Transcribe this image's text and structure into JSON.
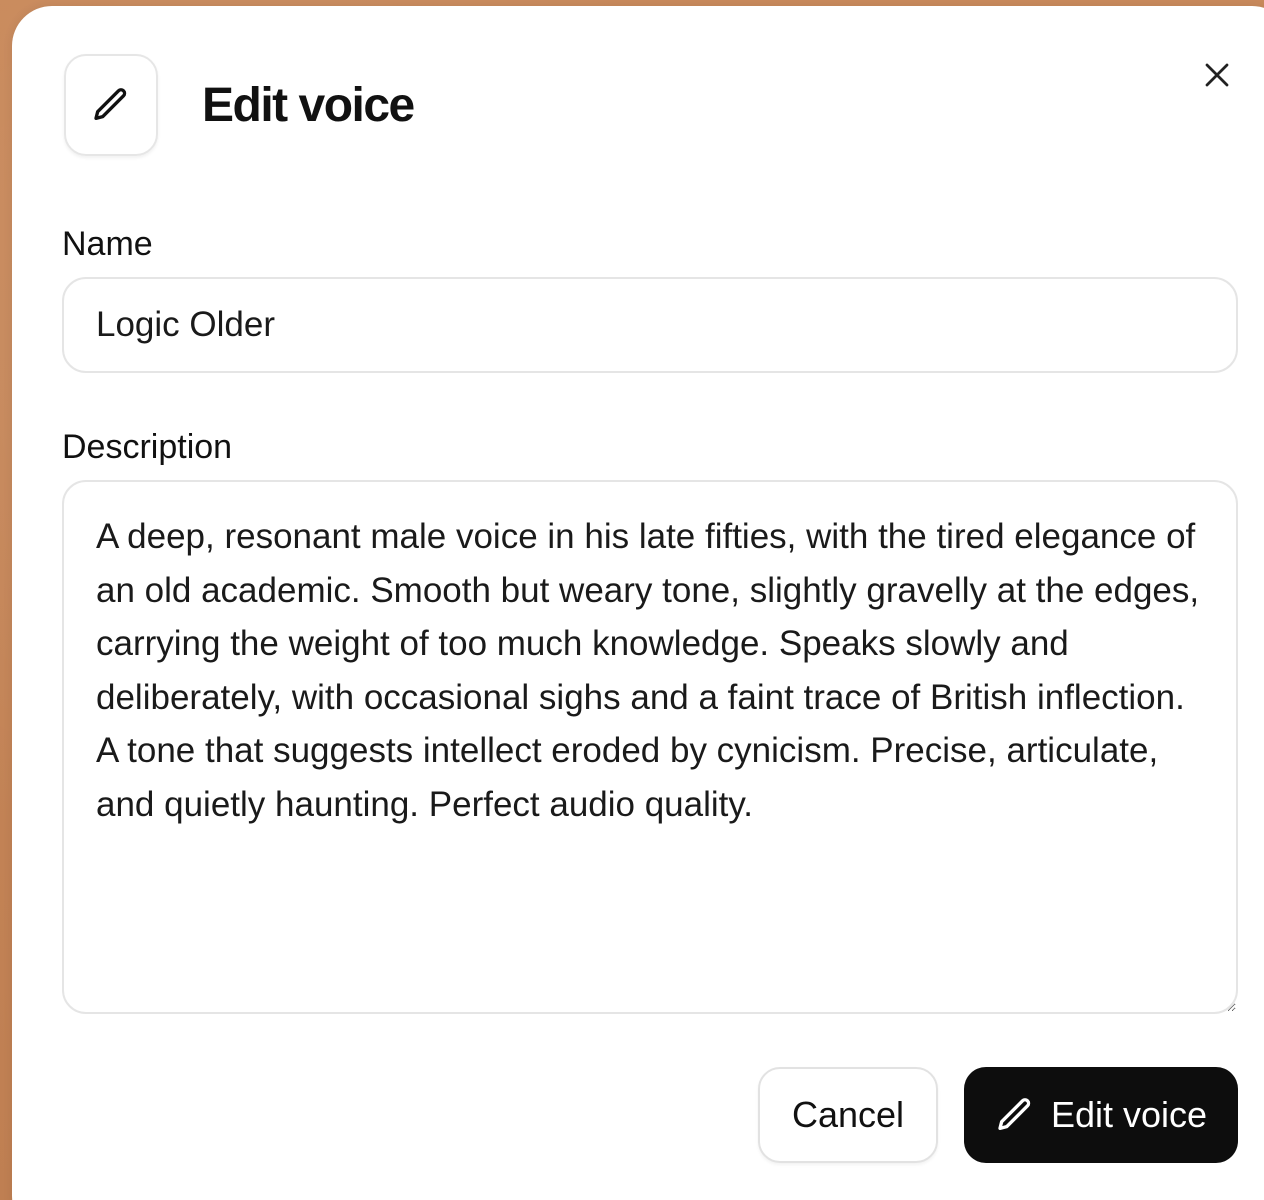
{
  "dialog": {
    "title": "Edit voice",
    "header_icon": "pencil-icon",
    "close_icon": "close-icon"
  },
  "form": {
    "name_label": "Name",
    "name_value": "Logic Older",
    "description_label": "Description",
    "description_value": "A deep, resonant male voice in his late fifties, with the tired elegance of an old academic. Smooth but weary tone, slightly gravelly at the edges, carrying the weight of too much knowledge. Speaks slowly and deliberately, with occasional sighs and a faint trace of British inflection. A tone that suggests intellect eroded by cynicism. Precise, articulate, and quietly haunting. Perfect audio quality."
  },
  "actions": {
    "cancel_label": "Cancel",
    "submit_label": "Edit voice",
    "submit_icon": "pencil-icon"
  },
  "colors": {
    "primary_button": "#0d0d0d",
    "backdrop": "#c8875a",
    "border": "#e5e5e5"
  }
}
